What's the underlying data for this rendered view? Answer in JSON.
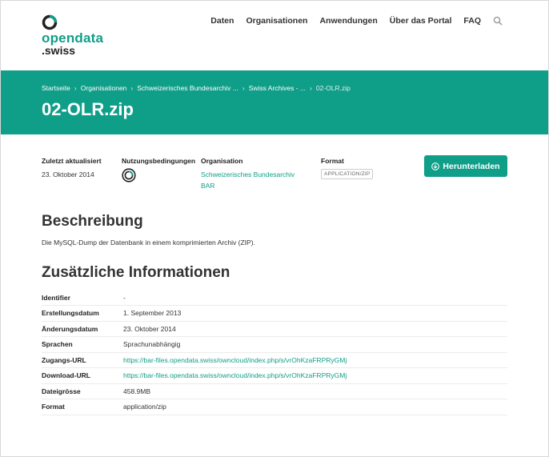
{
  "logo": {
    "line1": "opendata",
    "line2": ".swiss"
  },
  "nav": [
    "Daten",
    "Organisationen",
    "Anwendungen",
    "Über das Portal",
    "FAQ"
  ],
  "breadcrumb": [
    "Startseite",
    "Organisationen",
    "Schweizerisches Bundesarchiv ...",
    "Swiss Archives - ...",
    "02-OLR.zip"
  ],
  "title": "02-OLR.zip",
  "meta": {
    "updated_label": "Zuletzt aktualisiert",
    "updated_value": "23. Oktober 2014",
    "terms_label": "Nutzungsbedingungen",
    "org_label": "Organisation",
    "org_value_line1": "Schweizerisches Bundesarchiv",
    "org_value_line2": "BAR",
    "format_label": "Format",
    "format_value": "APPLICATION/ZIP"
  },
  "download_label": "Herunterladen",
  "description": {
    "heading": "Beschreibung",
    "text": "Die MySQL-Dump der Datenbank in einem komprimierten Archiv (ZIP)."
  },
  "additional": {
    "heading": "Zusätzliche Informationen",
    "rows": [
      {
        "key": "Identifier",
        "value": "-"
      },
      {
        "key": "Erstellungsdatum",
        "value": "1. September 2013"
      },
      {
        "key": "Änderungsdatum",
        "value": "23. Oktober 2014"
      },
      {
        "key": "Sprachen",
        "value": "Sprachunabhängig"
      },
      {
        "key": "Zugangs-URL",
        "value": "https://bar-files.opendata.swiss/owncloud/index.php/s/vrOhKzaFRPRyGMj"
      },
      {
        "key": "Download-URL",
        "value": "https://bar-files.opendata.swiss/owncloud/index.php/s/vrOhKzaFRPRyGMj"
      },
      {
        "key": "Dateigrösse",
        "value": "458.9MB"
      },
      {
        "key": "Format",
        "value": "application/zip"
      }
    ]
  },
  "colors": {
    "brand": "#0f9e88",
    "text": "#333333"
  },
  "icons": [
    "opendata-logo-icon",
    "search-icon",
    "license-icon",
    "download-icon"
  ]
}
